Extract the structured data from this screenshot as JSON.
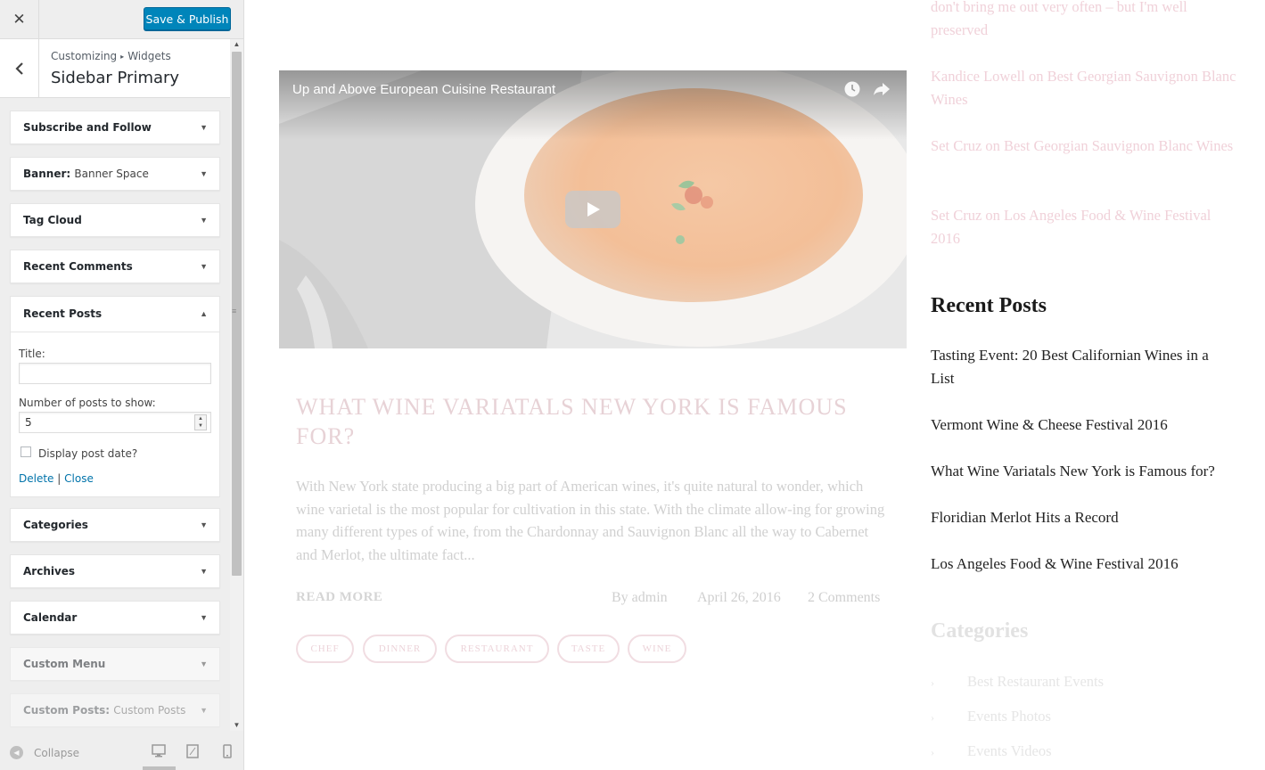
{
  "customizer": {
    "close_icon": "close-icon",
    "save_label": "Save & Publish",
    "breadcrumb": [
      "Customizing",
      "Widgets"
    ],
    "section_title": "Sidebar Primary",
    "widgets_top": [
      {
        "title": "Subscribe and Follow",
        "in_title": ""
      },
      {
        "title": "Banner:",
        "in_title": "Banner Space"
      },
      {
        "title": "Tag Cloud",
        "in_title": ""
      },
      {
        "title": "Recent Comments",
        "in_title": ""
      }
    ],
    "recent_posts_widget": {
      "title": "Recent Posts",
      "title_field_label": "Title:",
      "title_field_value": "",
      "number_label": "Number of posts to show:",
      "number_value": "5",
      "display_date_label": "Display post date?",
      "display_date_checked": false,
      "delete_label": "Delete",
      "separator": "|",
      "close_label": "Close"
    },
    "widgets_bottom": [
      {
        "title": "Categories",
        "in_title": ""
      },
      {
        "title": "Archives",
        "in_title": ""
      },
      {
        "title": "Calendar",
        "in_title": ""
      },
      {
        "title": "Custom Menu",
        "in_title": ""
      },
      {
        "title": "Custom Posts:",
        "in_title": "Custom Posts"
      }
    ],
    "collapse_label": "Collapse",
    "devices": [
      "desktop-icon",
      "tablet-icon",
      "mobile-icon"
    ],
    "active_device": "desktop"
  },
  "preview": {
    "video_title": "Up and Above European Cuisine Restaurant",
    "post": {
      "title": "What Wine Variatals New York is Famous for?",
      "excerpt": "With New York state producing a big part of American wines, it's quite natural to wonder, which wine varietal is the most popular for cultivation in this state. With the climate allow-ing for growing many different types of wine, from the Chardonnay and Sauvignon Blanc all the way to Cabernet and Merlot, the ultimate fact...",
      "read_more": "Read More",
      "author": "By admin",
      "date": "April 26, 2016",
      "comments": "2 Comments",
      "tags": [
        "chef",
        "dinner",
        "restaurant",
        "taste",
        "wine"
      ]
    },
    "sidebar": {
      "recent_comments": [
        "don't bring me out very often – but I'm well preserved",
        "Kandice Lowell on Best Georgian Sauvignon Blanc Wines",
        "Set Cruz on Best Georgian Sauvignon Blanc Wines",
        "Set Cruz on Los Angeles Food & Wine Festival 2016"
      ],
      "recent_posts_heading": "Recent Posts",
      "recent_posts": [
        "Tasting Event: 20 Best Californian Wines in a List",
        "Vermont Wine & Cheese Festival 2016",
        "What Wine Variatals New York is Famous for?",
        "Floridian Merlot Hits a Record",
        "Los Angeles Food & Wine Festival 2016"
      ],
      "categories_heading": "Categories",
      "categories": [
        "Best Restaurant Events",
        "Events Photos",
        "Events Videos"
      ]
    },
    "colors": {
      "accent_pink": "#f0d1d9",
      "wp_blue": "#0085ba"
    }
  }
}
